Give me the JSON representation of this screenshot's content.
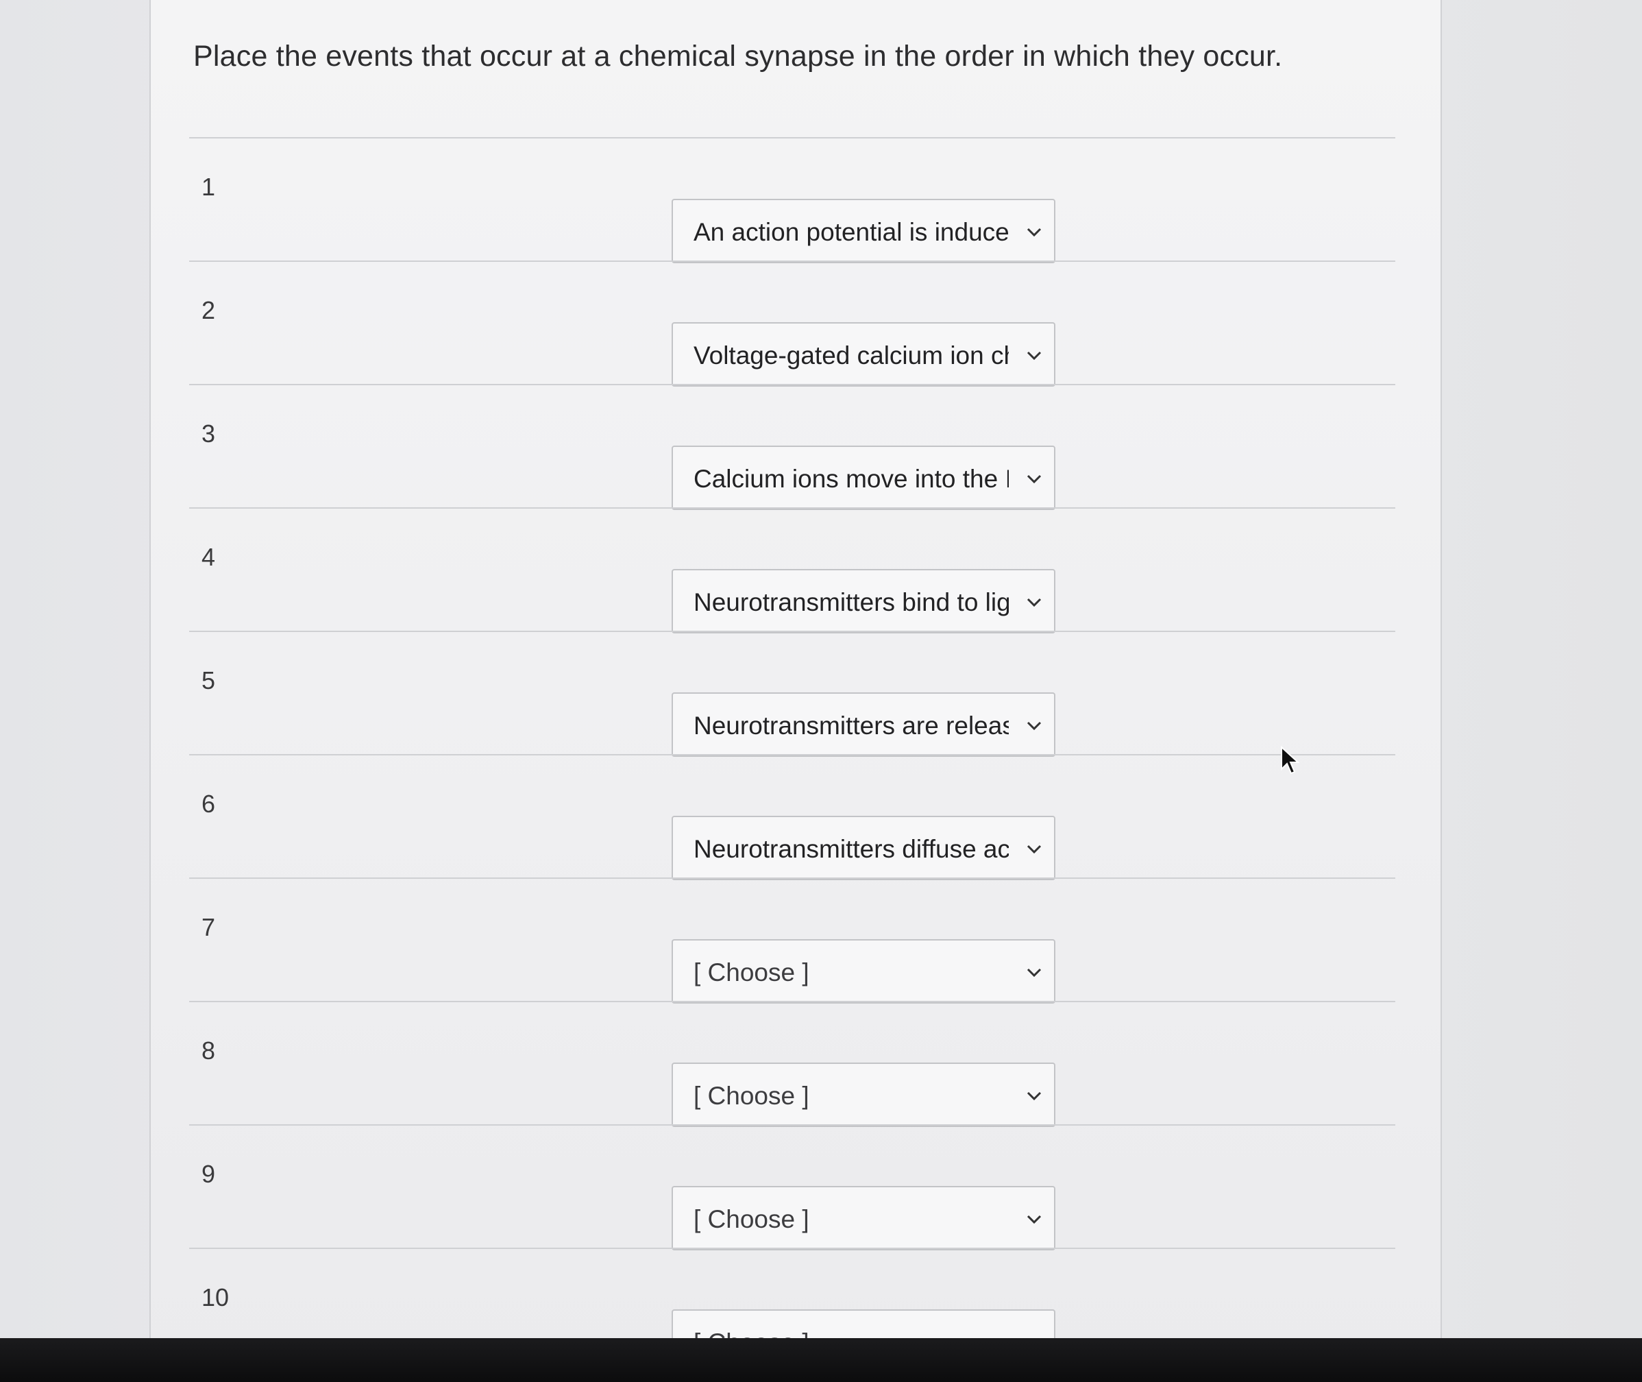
{
  "question": {
    "text": "Place the events that occur at a chemical synapse in the order in which they occur."
  },
  "rows": [
    {
      "number": "1",
      "selected": "An action potential is induced",
      "is_placeholder": false
    },
    {
      "number": "2",
      "selected": "Voltage-gated calcium ion cha",
      "is_placeholder": false
    },
    {
      "number": "3",
      "selected": "Calcium ions move into the IC",
      "is_placeholder": false
    },
    {
      "number": "4",
      "selected": "Neurotransmitters bind to liga",
      "is_placeholder": false
    },
    {
      "number": "5",
      "selected": "Neurotransmitters are release",
      "is_placeholder": false
    },
    {
      "number": "6",
      "selected": "Neurotransmitters diffuse acr",
      "is_placeholder": false
    },
    {
      "number": "7",
      "selected": "[ Choose ]",
      "is_placeholder": true
    },
    {
      "number": "8",
      "selected": "[ Choose ]",
      "is_placeholder": true
    },
    {
      "number": "9",
      "selected": "[ Choose ]",
      "is_placeholder": true
    },
    {
      "number": "10",
      "selected": "[ Choose ]",
      "is_placeholder": true
    }
  ],
  "icons": {
    "dropdown": "chevron-down-icon",
    "cursor": "mouse-pointer-icon"
  },
  "colors": {
    "text": "#222224",
    "border": "#c3c4c7",
    "background": "#f4f4f5"
  }
}
